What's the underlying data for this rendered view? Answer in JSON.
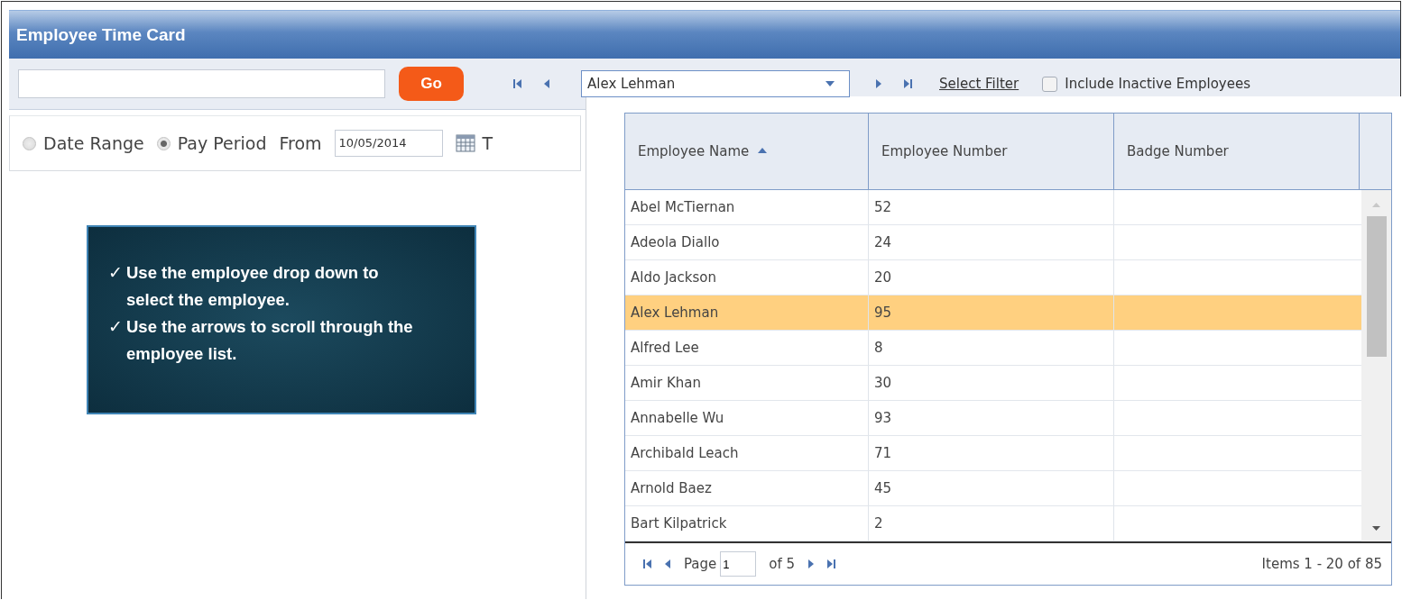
{
  "window": {
    "title": "Employee Time Card"
  },
  "toolbar": {
    "go_button": "Go",
    "employee_select": {
      "value": "Alex Lehman"
    },
    "select_filter": "Select Filter",
    "include_inactive": {
      "label": "Include Inactive Employees",
      "checked": false
    }
  },
  "period": {
    "options": [
      {
        "label": "Date Range",
        "selected": false
      },
      {
        "label": "Pay Period",
        "selected": true
      }
    ],
    "from_label": "From",
    "from_date": "10/05/2014",
    "to_label": "T"
  },
  "callout": {
    "items": [
      {
        "mark": "✓",
        "text": "Use the employee drop down to select the employee."
      },
      {
        "mark": "✓",
        "text": "Use the arrows to scroll through the employee list."
      }
    ]
  },
  "employee_grid": {
    "columns": [
      {
        "label": "Employee Name",
        "sorted_ascending": true
      },
      {
        "label": "Employee Number",
        "sorted_ascending": false
      },
      {
        "label": "Badge Number",
        "sorted_ascending": false
      }
    ],
    "rows": [
      {
        "cells": [
          "Abel McTiernan",
          "52"
        ],
        "selected": false
      },
      {
        "cells": [
          "Adeola Diallo",
          "24"
        ],
        "selected": false
      },
      {
        "cells": [
          "Aldo Jackson",
          "20"
        ],
        "selected": false
      },
      {
        "cells": [
          "Alex Lehman",
          "95"
        ],
        "selected": true
      },
      {
        "cells": [
          "Alfred Lee",
          "8"
        ],
        "selected": false
      },
      {
        "cells": [
          "Amir Khan",
          "30"
        ],
        "selected": false
      },
      {
        "cells": [
          "Annabelle Wu",
          "93"
        ],
        "selected": false
      },
      {
        "cells": [
          "Archibald Leach",
          "71"
        ],
        "selected": false
      },
      {
        "cells": [
          "Arnold Baez",
          "45"
        ],
        "selected": false
      },
      {
        "cells": [
          "Bart Kilpatrick",
          "2"
        ],
        "selected": false
      }
    ],
    "pager": {
      "page_label": "Page",
      "page": "1",
      "of_label": "of 5",
      "items": "Items 1 - 20 of 85"
    }
  }
}
